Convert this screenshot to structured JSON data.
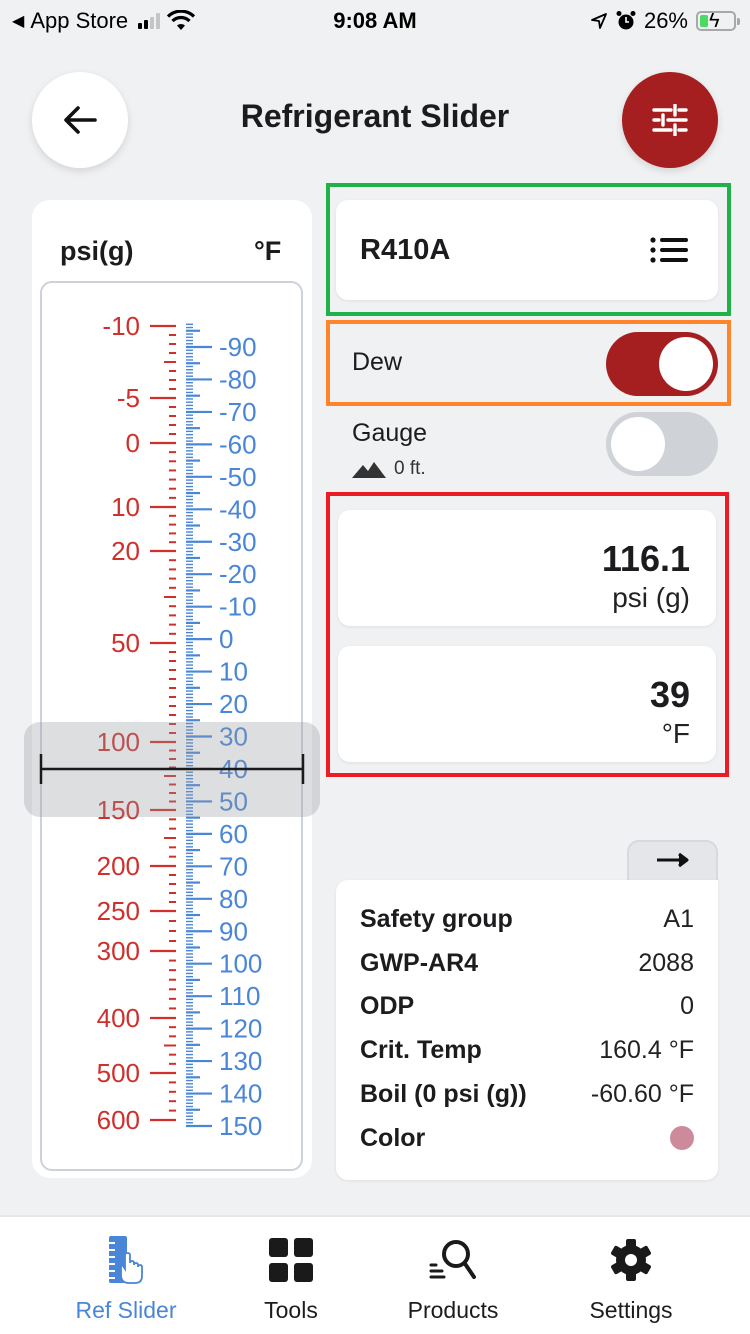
{
  "status_bar": {
    "back_app": "App Store",
    "time": "9:08 AM",
    "battery": "26%",
    "icons": [
      "back-triangle-icon",
      "signal-icon",
      "wifi-icon",
      "location-icon",
      "alarm-icon",
      "battery-charging-icon"
    ]
  },
  "header": {
    "title": "Refrigerant Slider",
    "back_icon": "arrow-left-icon",
    "filter_icon": "sliders-icon"
  },
  "ruler": {
    "left_unit": "psi(g)",
    "right_unit": "°F",
    "psi_color": "#d0302c",
    "temp_color": "#4a86d8",
    "psi_labels": [
      "-10",
      "-5",
      "0",
      "10",
      "20",
      "50",
      "100",
      "150",
      "200",
      "250",
      "300",
      "400",
      "500",
      "600"
    ],
    "temp_labels": [
      "-90",
      "-80",
      "-70",
      "-60",
      "-50",
      "-40",
      "-30",
      "-20",
      "-10",
      "0",
      "10",
      "20",
      "30",
      "40",
      "50",
      "60",
      "70",
      "80",
      "90",
      "100",
      "110",
      "120",
      "130",
      "140",
      "150"
    ],
    "selected_temp_f": 39,
    "selected_psi": 116.1
  },
  "refrigerant": {
    "name": "R410A",
    "list_icon": "list-icon"
  },
  "toggles": {
    "dew": {
      "label": "Dew",
      "on": true
    },
    "gauge": {
      "label": "Gauge",
      "on": false,
      "altitude": "0 ft.",
      "altitude_icon": "mountain-icon"
    }
  },
  "readings": {
    "pressure": {
      "value": "116.1",
      "unit": "psi (g)"
    },
    "temperature": {
      "value": "39",
      "unit": "°F"
    }
  },
  "properties": {
    "tab_icon": "arrow-right-icon",
    "rows": [
      {
        "label": "Safety group",
        "value": "A1"
      },
      {
        "label": "GWP-AR4",
        "value": "2088"
      },
      {
        "label": "ODP",
        "value": "0"
      },
      {
        "label": "Crit. Temp",
        "value": "160.4 °F"
      },
      {
        "label": "Boil (0 psi (g))",
        "value": "-60.60 °F"
      },
      {
        "label": "Color",
        "value": ""
      }
    ],
    "color_swatch": "#cc8a9a"
  },
  "bottom_nav": {
    "items": [
      {
        "label": "Ref Slider",
        "icon": "ruler-hand-icon",
        "active": true
      },
      {
        "label": "Tools",
        "icon": "grid-icon",
        "active": false
      },
      {
        "label": "Products",
        "icon": "search-list-icon",
        "active": false
      },
      {
        "label": "Settings",
        "icon": "gear-icon",
        "active": false
      }
    ]
  },
  "colors": {
    "accent_red": "#a51f20",
    "active_blue": "#4a86d8",
    "background": "#f0f1f3"
  }
}
